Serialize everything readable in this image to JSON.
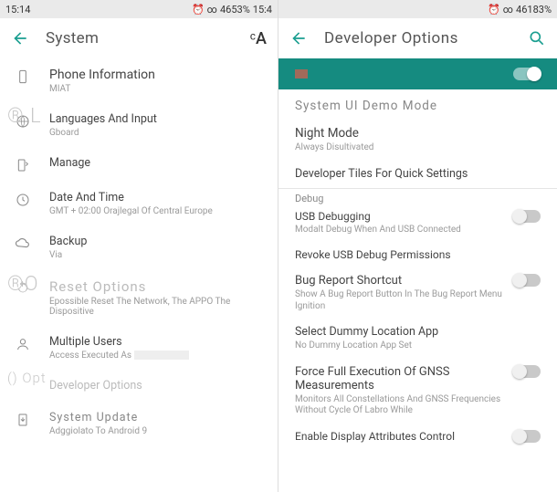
{
  "left": {
    "status": {
      "time": "15:14",
      "clock": "⏰",
      "link": "∞",
      "pct": "4653%",
      "timeR": "15:4"
    },
    "appbar": {
      "title": "System"
    },
    "ghost": {
      "l": "® L",
      "ro": "®O",
      "opt": "() Opt"
    },
    "rows": {
      "phone": {
        "title": "Phone Information",
        "sub": "MIAT"
      },
      "lang": {
        "title": "Languages And Input",
        "sub": "Gboard"
      },
      "manage": {
        "title": "Manage"
      },
      "date": {
        "title": "Date And Time",
        "sub": "GMT + 02:00 Orajlegal Of Central Europe"
      },
      "backup": {
        "title": "Backup",
        "sub": "Via"
      },
      "reset": {
        "title": "Reset Options",
        "sub": "Epossible Reset The Network, The APPO The Dispositive"
      },
      "users": {
        "title": "Multiple Users",
        "sub": "Access Executed As "
      },
      "dev": {
        "title": "Developer Options"
      },
      "update": {
        "title": "System Update",
        "sub": "Adggiolato To Android 9"
      }
    }
  },
  "right": {
    "status": {
      "clock": "⏰",
      "link": "∞",
      "pct": "46183%"
    },
    "appbar": {
      "title": "Developer Options"
    },
    "banner": {
      "badge": "On"
    },
    "items": {
      "demo": {
        "title": "System UI Demo Mode"
      },
      "night": {
        "title": "Night Mode",
        "sub": "Always Disultivated"
      },
      "tiles": {
        "title": "Developer Tiles For Quick Settings"
      },
      "section_debug": "Debug",
      "usb": {
        "title": "USB Debugging",
        "sub": "Modalt Debug When And USB Connected"
      },
      "revoke": {
        "title": "Revoke USB Debug Permissions"
      },
      "bugrep": {
        "title": "Bug Report Shortcut",
        "sub": "Show A Bug Report Button In The Bug Report Menu Ignition"
      },
      "dummy": {
        "title": "Select Dummy Location App",
        "sub": "No Dummy Location App Set"
      },
      "gnss": {
        "title": "Force Full Execution Of GNSS Measurements",
        "sub": "Monitors All Constellations And GNSS Frequencies Without Cycle Of Labro While"
      },
      "attrs": {
        "title": "Enable Display Attributes Control"
      }
    }
  }
}
